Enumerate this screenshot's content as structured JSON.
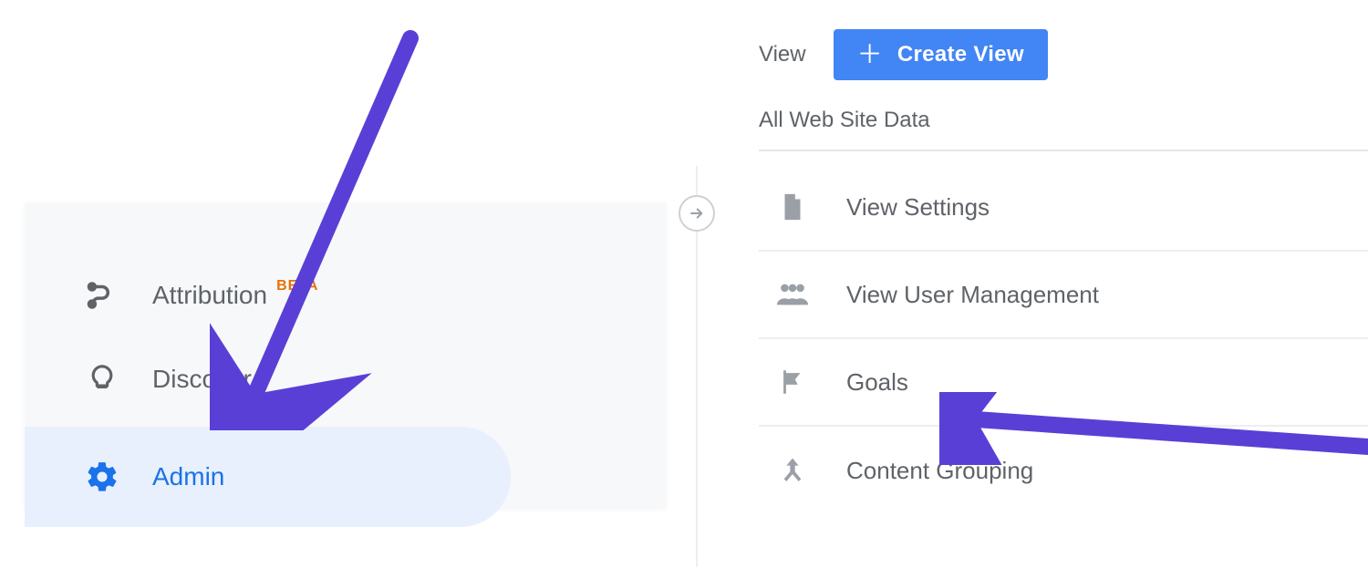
{
  "sidebar": {
    "items": [
      {
        "label": "Attribution",
        "badge": "BETA"
      },
      {
        "label": "Discover"
      },
      {
        "label": "Admin"
      }
    ]
  },
  "view": {
    "column_label": "View",
    "create_button": "Create View",
    "subtitle": "All Web Site Data",
    "settings": [
      {
        "label": "View Settings"
      },
      {
        "label": "View User Management"
      },
      {
        "label": "Goals"
      },
      {
        "label": "Content Grouping"
      }
    ]
  }
}
